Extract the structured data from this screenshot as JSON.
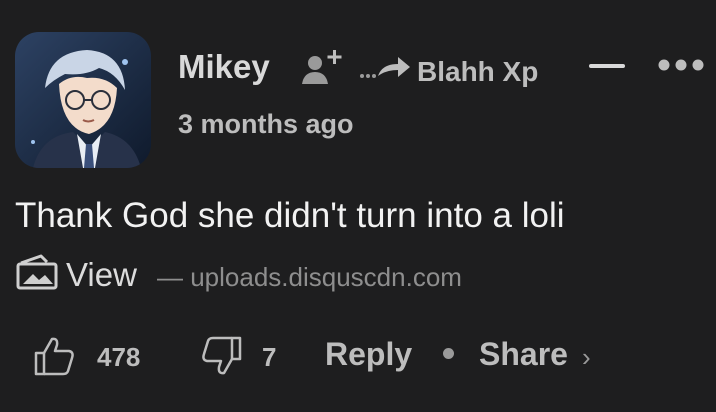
{
  "comment": {
    "author": "Mikey",
    "reply_to": "Blahh Xp",
    "reply_indicator": "...",
    "timestamp": "3 months ago",
    "text": "Thank God she didn't turn into a loli",
    "media": {
      "view_label": "View",
      "source": "— uploads.disquscdn.com"
    },
    "votes": {
      "upvotes": "478",
      "downvotes": "7"
    },
    "actions": {
      "reply_label": "Reply",
      "share_label": "Share",
      "share_chevron": "›"
    }
  },
  "icons": {
    "follow": "follow-user-icon",
    "reply_arrow": "reply-arrow-icon",
    "collapse": "collapse-icon",
    "more": "more-options-icon",
    "media": "media-image-icon",
    "upvote": "thumbs-up-icon",
    "downvote": "thumbs-down-icon"
  },
  "colors": {
    "background": "#1e1e1f",
    "text_primary": "#f2f2f2",
    "text_secondary": "#bdbdbd",
    "text_muted": "#8e8e8e"
  }
}
